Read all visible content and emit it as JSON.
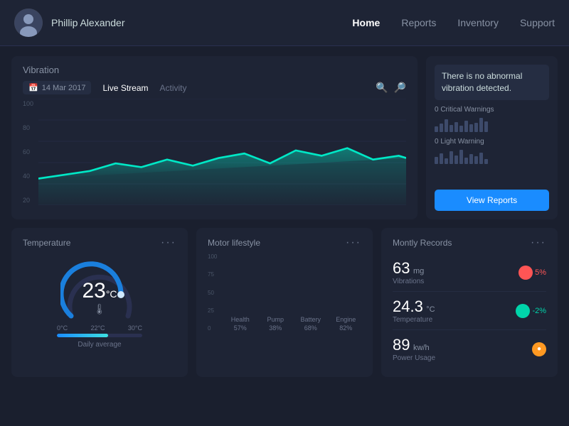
{
  "navbar": {
    "username": "Phillip Alexander",
    "links": [
      {
        "label": "Home",
        "active": true
      },
      {
        "label": "Reports",
        "active": false
      },
      {
        "label": "Inventory",
        "active": false
      },
      {
        "label": "Support",
        "active": false
      }
    ]
  },
  "vibration": {
    "title": "Vibration",
    "date": "14 Mar 2017",
    "tabs": [
      {
        "label": "Live Stream",
        "active": true
      },
      {
        "label": "Activity",
        "active": false
      }
    ],
    "y_labels": [
      "100",
      "80",
      "60",
      "40",
      "20"
    ],
    "alert_message": "There is no abnormal vibration detected.",
    "critical_warnings_label": "0 Critical Warnings",
    "light_warning_label": "0 Light Warning",
    "view_reports_btn": "View Reports"
  },
  "temperature": {
    "title": "Temperature",
    "value": "23",
    "unit": "°C",
    "min_temp": "0°C",
    "current_temp": "22°C",
    "max_temp": "30°C",
    "daily_avg": "Daily average",
    "dots": "···"
  },
  "motor": {
    "title": "Motor lifestyle",
    "dots": "···",
    "y_labels": [
      "100",
      "75",
      "50",
      "25",
      "0"
    ],
    "bars": [
      {
        "label": "Health",
        "pct": "57%",
        "height_pct": 57,
        "color": "blue"
      },
      {
        "label": "Pump",
        "pct": "38%",
        "height_pct": 38,
        "color": "blue"
      },
      {
        "label": "Battery",
        "pct": "68%",
        "height_pct": 68,
        "color": "teal"
      },
      {
        "label": "Engine",
        "pct": "82%",
        "height_pct": 82,
        "color": "teal"
      }
    ]
  },
  "monthly": {
    "title": "Montly Records",
    "dots": "···",
    "metrics": [
      {
        "value": "63",
        "unit": "mg",
        "name": "Vibrations",
        "change": "5%",
        "direction": "up"
      },
      {
        "value": "24.3",
        "unit": "°C",
        "name": "Temperature",
        "change": "-2%",
        "direction": "down"
      },
      {
        "value": "89",
        "unit": "kw/h",
        "name": "Power Usage",
        "change": "",
        "direction": "neutral"
      }
    ]
  }
}
